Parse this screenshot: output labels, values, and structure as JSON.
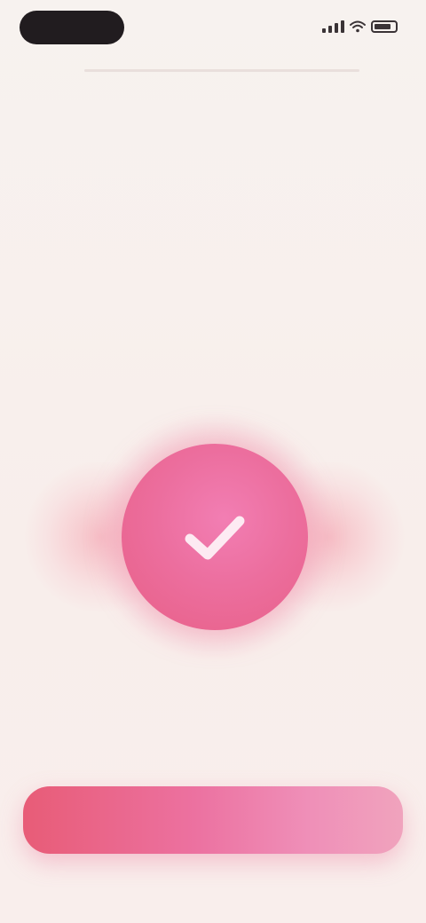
{
  "status_bar": {
    "time": "",
    "icons": [
      "signal-icon",
      "wifi-icon",
      "battery-icon"
    ]
  },
  "content": {
    "eyebrow": "",
    "headline_lines": [
      "",
      "",
      ""
    ]
  },
  "visual": {
    "icon": "check-icon",
    "accent_color": "#ec6e9e",
    "glow_color": "#f6b0ba"
  },
  "primary_button": {
    "label": ""
  },
  "colors": {
    "background": "#f6efec",
    "text": "#2a2326",
    "eyebrow": "#e9a3a6",
    "button_start": "#e85c77",
    "button_end": "#f0a3bd"
  }
}
